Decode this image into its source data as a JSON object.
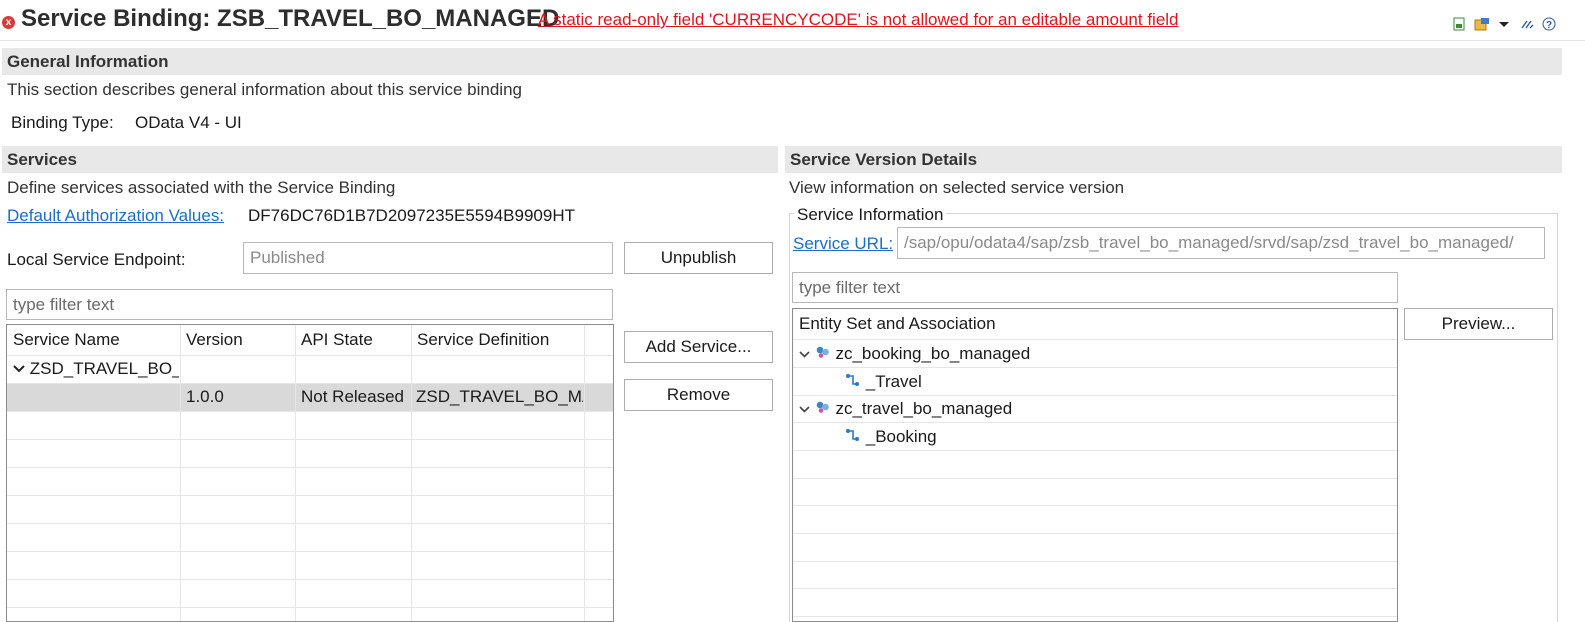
{
  "header": {
    "title": "Service Binding: ZSB_TRAVEL_BO_MANAGED",
    "error_message": "A static read-only field 'CURRENCYCODE' is not allowed for an editable amount field",
    "error_icon": "x",
    "toolbar_icons": [
      "export-icon",
      "settings-icon",
      "dropdown-icon",
      "link-icon",
      "help-icon"
    ]
  },
  "general": {
    "heading": "General Information",
    "description": "This section describes general information about this service binding",
    "binding_type_label": "Binding Type:",
    "binding_type_value": "OData V4 - UI"
  },
  "services": {
    "heading": "Services",
    "description": "Define services associated with the Service Binding",
    "auth_link": "Default Authorization Values:",
    "auth_value": "DF76DC76D1B7D2097235E5594B9909HT",
    "endpoint_label": "Local Service Endpoint:",
    "endpoint_value": "Published",
    "unpublish_label": "Unpublish",
    "filter_placeholder": "type filter text",
    "add_service_label": "Add Service...",
    "remove_label": "Remove",
    "columns": [
      "Service Name",
      "Version",
      "API State",
      "Service Definition"
    ],
    "group_name": "ZSD_TRAVEL_BO_M",
    "row": {
      "version": "1.0.0",
      "api_state": "Not Released",
      "definition": "ZSD_TRAVEL_BO_MAI"
    }
  },
  "version_details": {
    "heading": "Service Version Details",
    "description": "View information on selected service version",
    "group_label": "Service Information",
    "url_link": "Service URL:",
    "url_value": "/sap/opu/odata4/sap/zsb_travel_bo_managed/srvd/sap/zsd_travel_bo_managed/",
    "filter_placeholder": "type filter text",
    "preview_label": "Preview...",
    "column": "Entity Set and Association",
    "entities": [
      {
        "name": "zc_booking_bo_managed",
        "association": "_Travel"
      },
      {
        "name": "zc_travel_bo_managed",
        "association": "_Booking"
      }
    ]
  },
  "colors": {
    "error": "#e0141e",
    "link": "#1a6fc9",
    "section_bg": "#e8e8e8",
    "selection": "#d9d9d9"
  }
}
